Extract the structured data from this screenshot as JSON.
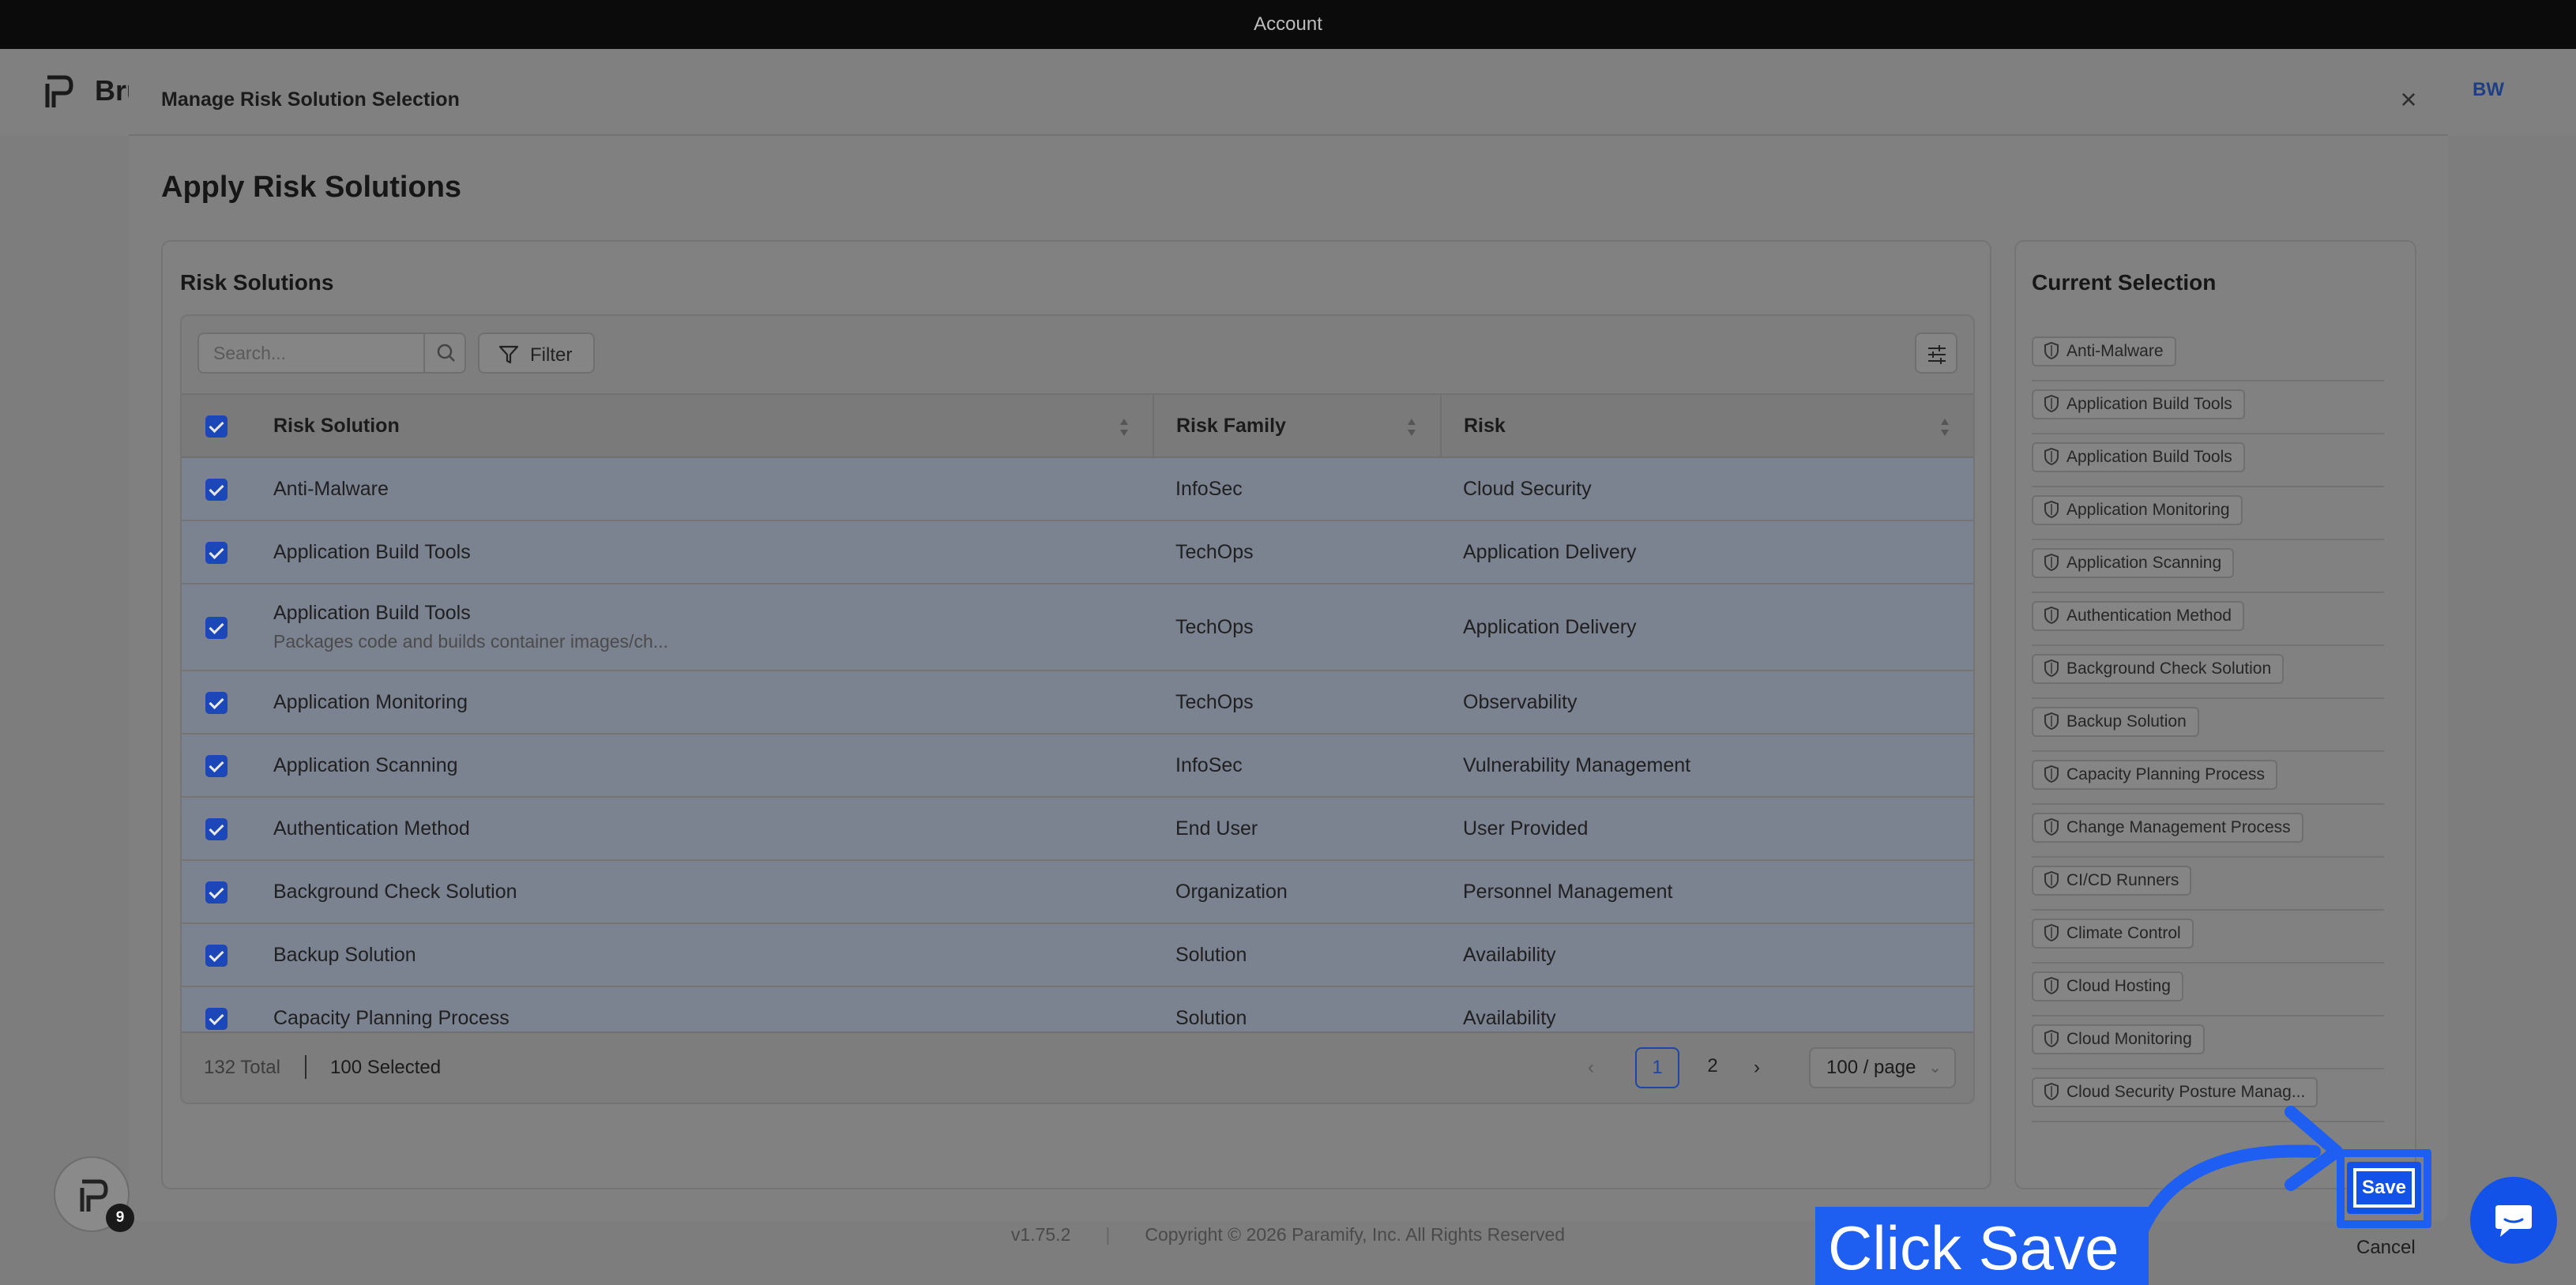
{
  "topbar": {
    "title": "Account"
  },
  "app": {
    "brand": "Bru",
    "avatar": "BW"
  },
  "footer": {
    "version": "v1.75.2",
    "copyright": "Copyright © 2026 Paramify, Inc. All Rights Reserved"
  },
  "modal": {
    "title": "Manage Risk Solution Selection",
    "heading": "Apply Risk Solutions",
    "cancel_label": "Cancel",
    "save_label": "Save"
  },
  "risk_solutions": {
    "title": "Risk Solutions",
    "search_placeholder": "Search...",
    "filter_label": "Filter",
    "columns": {
      "solution": "Risk Solution",
      "family": "Risk Family",
      "risk": "Risk"
    },
    "rows": [
      {
        "solution": "Anti-Malware",
        "description": "",
        "family": "InfoSec",
        "risk": "Cloud Security"
      },
      {
        "solution": "Application Build Tools",
        "description": "",
        "family": "TechOps",
        "risk": "Application Delivery"
      },
      {
        "solution": "Application Build Tools",
        "description": "Packages code and builds container images/ch...",
        "family": "TechOps",
        "risk": "Application Delivery"
      },
      {
        "solution": "Application Monitoring",
        "description": "",
        "family": "TechOps",
        "risk": "Observability"
      },
      {
        "solution": "Application Scanning",
        "description": "",
        "family": "InfoSec",
        "risk": "Vulnerability Management"
      },
      {
        "solution": "Authentication Method",
        "description": "",
        "family": "End User",
        "risk": "User Provided"
      },
      {
        "solution": "Background Check Solution",
        "description": "",
        "family": "Organization",
        "risk": "Personnel Management"
      },
      {
        "solution": "Backup Solution",
        "description": "",
        "family": "Solution",
        "risk": "Availability"
      },
      {
        "solution": "Capacity Planning Process",
        "description": "",
        "family": "Solution",
        "risk": "Availability"
      }
    ],
    "total": "132 Total",
    "selected": "100 Selected",
    "pages": [
      "1",
      "2"
    ],
    "current_page": "1",
    "page_size": "100 / page"
  },
  "current_selection": {
    "title": "Current Selection",
    "items": [
      "Anti-Malware",
      "Application Build Tools",
      "Application Build Tools",
      "Application Monitoring",
      "Application Scanning",
      "Authentication Method",
      "Background Check Solution",
      "Backup Solution",
      "Capacity Planning Process",
      "Change Management Process",
      "CI/CD Runners",
      "Climate Control",
      "Cloud Hosting",
      "Cloud Monitoring",
      "Cloud Security Posture Manag..."
    ]
  },
  "callout": {
    "text": "Click Save"
  },
  "badge": {
    "count": "9"
  },
  "colors": {
    "accent": "#1352e8",
    "checkbox": "#1b47b8",
    "callout": "#1e5ef0"
  }
}
